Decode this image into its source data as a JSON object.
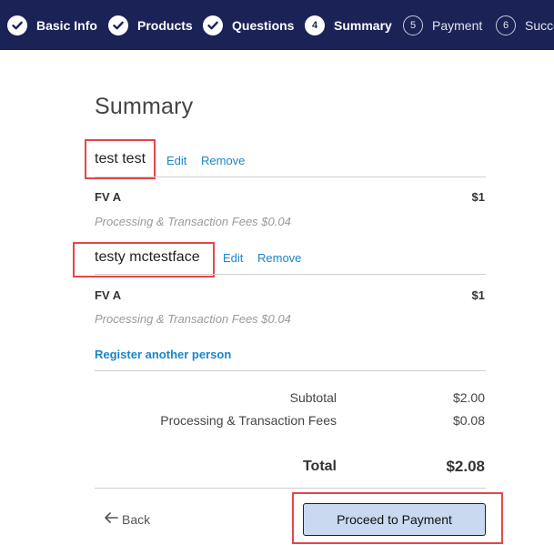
{
  "stepper": {
    "steps": [
      {
        "number": "",
        "label": "Basic Info",
        "state": "done",
        "icon": "check-icon"
      },
      {
        "number": "",
        "label": "Products",
        "state": "done",
        "icon": "check-icon"
      },
      {
        "number": "",
        "label": "Questions",
        "state": "done",
        "icon": "check-icon"
      },
      {
        "number": "4",
        "label": "Summary",
        "state": "current"
      },
      {
        "number": "5",
        "label": "Payment",
        "state": "pending"
      },
      {
        "number": "6",
        "label": "Success",
        "state": "pending"
      }
    ],
    "colors": {
      "background": "#1b2256",
      "text": "#ffffff"
    }
  },
  "summary": {
    "title": "Summary",
    "edit_label": "Edit",
    "remove_label": "Remove",
    "people": [
      {
        "name": "test test",
        "items": [
          {
            "name": "FV A",
            "price": "$1",
            "fee_note": "Processing & Transaction Fees $0.04"
          }
        ]
      },
      {
        "name": "testy mctestface",
        "items": [
          {
            "name": "FV A",
            "price": "$1",
            "fee_note": "Processing & Transaction Fees $0.04"
          }
        ]
      }
    ],
    "register_another": "Register another person"
  },
  "totals": {
    "subtotal_label": "Subtotal",
    "subtotal_value": "$2.00",
    "fees_label": "Processing & Transaction Fees",
    "fees_value": "$0.08",
    "total_label": "Total",
    "total_value": "$2.08"
  },
  "actions": {
    "back_label": "Back",
    "proceed_label": "Proceed to Payment"
  },
  "colors": {
    "link": "#1a86c9",
    "highlight": "#e4454a",
    "proceed_button": "#c8d9f0"
  }
}
